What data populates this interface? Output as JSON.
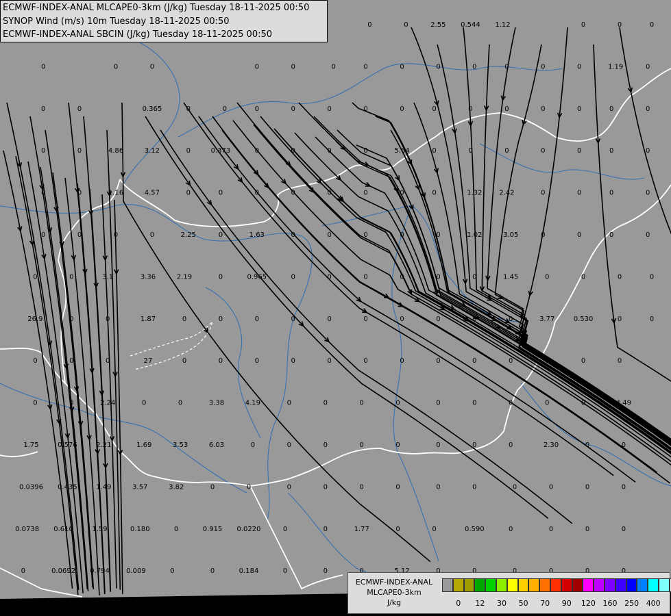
{
  "header": {
    "line1": "ECMWF-INDEX-ANAL MLCAPE0-3km (J/kg) Tuesday 18-11-2025 00:50",
    "line2": "SYNOP Wind (m/s) 10m Tuesday 18-11-2025 00:50",
    "line3": "ECMWF-INDEX-ANAL SBCIN (J/kg) Tuesday 18-11-2025 00:50"
  },
  "colors": {
    "background": "#999999",
    "rivers": "#2e6db4",
    "borders": "#ffffff",
    "streamlines": "#000000"
  },
  "value_labels": [
    {
      "text": "2.55",
      "col": 10.5,
      "row": 0
    },
    {
      "text": "0.544",
      "col": 11.3,
      "row": 0
    },
    {
      "text": "1.12",
      "col": 12.1,
      "row": 0
    },
    {
      "text": "0",
      "col": 8.8,
      "row": 0
    },
    {
      "text": "0",
      "col": 9.7,
      "row": 0
    },
    {
      "text": "0",
      "col": 14.1,
      "row": 0
    },
    {
      "text": "0",
      "col": 15.0,
      "row": 0
    },
    {
      "text": "0",
      "col": 15.8,
      "row": 0
    },
    {
      "text": "0",
      "col": 0.7,
      "row": 1
    },
    {
      "text": "0",
      "col": 2.5,
      "row": 1
    },
    {
      "text": "0",
      "col": 3.4,
      "row": 1
    },
    {
      "text": "0",
      "col": 6.0,
      "row": 1
    },
    {
      "text": "0",
      "col": 6.9,
      "row": 1
    },
    {
      "text": "0",
      "col": 7.9,
      "row": 1
    },
    {
      "text": "0",
      "col": 8.7,
      "row": 1
    },
    {
      "text": "0",
      "col": 9.6,
      "row": 1
    },
    {
      "text": "0",
      "col": 10.5,
      "row": 1
    },
    {
      "text": "0",
      "col": 11.4,
      "row": 1
    },
    {
      "text": "0",
      "col": 12.2,
      "row": 1
    },
    {
      "text": "0",
      "col": 13.1,
      "row": 1
    },
    {
      "text": "0",
      "col": 14.0,
      "row": 1
    },
    {
      "text": "1.19",
      "col": 14.9,
      "row": 1
    },
    {
      "text": "0",
      "col": 15.7,
      "row": 1
    },
    {
      "text": "0",
      "col": 0.7,
      "row": 2
    },
    {
      "text": "0",
      "col": 1.6,
      "row": 2
    },
    {
      "text": "0.365",
      "col": 3.4,
      "row": 2
    },
    {
      "text": "0",
      "col": 4.3,
      "row": 2
    },
    {
      "text": "0",
      "col": 5.2,
      "row": 2
    },
    {
      "text": "0",
      "col": 6.0,
      "row": 2
    },
    {
      "text": "0",
      "col": 6.9,
      "row": 2
    },
    {
      "text": "0",
      "col": 7.8,
      "row": 2
    },
    {
      "text": "0",
      "col": 8.7,
      "row": 2
    },
    {
      "text": "0",
      "col": 9.6,
      "row": 2
    },
    {
      "text": "0",
      "col": 10.4,
      "row": 2
    },
    {
      "text": "0",
      "col": 11.3,
      "row": 2
    },
    {
      "text": "0",
      "col": 12.2,
      "row": 2
    },
    {
      "text": "0",
      "col": 13.1,
      "row": 2
    },
    {
      "text": "0",
      "col": 14.0,
      "row": 2
    },
    {
      "text": "0",
      "col": 14.8,
      "row": 2
    },
    {
      "text": "0",
      "col": 15.7,
      "row": 2
    },
    {
      "text": "0",
      "col": 0.7,
      "row": 3
    },
    {
      "text": "0",
      "col": 1.6,
      "row": 3
    },
    {
      "text": "4.86",
      "col": 2.5,
      "row": 3
    },
    {
      "text": "3.12",
      "col": 3.4,
      "row": 3
    },
    {
      "text": "0",
      "col": 4.3,
      "row": 3
    },
    {
      "text": "0.373",
      "col": 5.1,
      "row": 3
    },
    {
      "text": "0",
      "col": 6.0,
      "row": 3
    },
    {
      "text": "0",
      "col": 6.9,
      "row": 3
    },
    {
      "text": "0",
      "col": 7.8,
      "row": 3
    },
    {
      "text": "0",
      "col": 8.7,
      "row": 3
    },
    {
      "text": "5.64",
      "col": 9.6,
      "row": 3
    },
    {
      "text": "0",
      "col": 10.4,
      "row": 3
    },
    {
      "text": "0",
      "col": 11.3,
      "row": 3
    },
    {
      "text": "0",
      "col": 12.2,
      "row": 3
    },
    {
      "text": "0",
      "col": 13.1,
      "row": 3
    },
    {
      "text": "0",
      "col": 14.0,
      "row": 3
    },
    {
      "text": "0",
      "col": 14.8,
      "row": 3
    },
    {
      "text": "0",
      "col": 15.7,
      "row": 3
    },
    {
      "text": "0",
      "col": 0.7,
      "row": 4
    },
    {
      "text": "0",
      "col": 1.6,
      "row": 4
    },
    {
      "text": "1.16",
      "col": 2.5,
      "row": 4
    },
    {
      "text": "4.57",
      "col": 3.4,
      "row": 4
    },
    {
      "text": "0",
      "col": 4.3,
      "row": 4
    },
    {
      "text": "0",
      "col": 5.1,
      "row": 4
    },
    {
      "text": "0",
      "col": 6.0,
      "row": 4
    },
    {
      "text": "0",
      "col": 6.9,
      "row": 4
    },
    {
      "text": "0",
      "col": 7.8,
      "row": 4
    },
    {
      "text": "0",
      "col": 8.7,
      "row": 4
    },
    {
      "text": "0",
      "col": 9.6,
      "row": 4
    },
    {
      "text": "0",
      "col": 10.4,
      "row": 4
    },
    {
      "text": "1.32",
      "col": 11.4,
      "row": 4
    },
    {
      "text": "2.42",
      "col": 12.2,
      "row": 4
    },
    {
      "text": "0",
      "col": 13.1,
      "row": 4
    },
    {
      "text": "0",
      "col": 14.0,
      "row": 4
    },
    {
      "text": "0",
      "col": 14.8,
      "row": 4
    },
    {
      "text": "0",
      "col": 15.7,
      "row": 4
    },
    {
      "text": "0",
      "col": 0.7,
      "row": 5
    },
    {
      "text": "0",
      "col": 1.6,
      "row": 5
    },
    {
      "text": "0",
      "col": 2.5,
      "row": 5
    },
    {
      "text": "0",
      "col": 3.4,
      "row": 5
    },
    {
      "text": "2.25",
      "col": 4.3,
      "row": 5
    },
    {
      "text": "0",
      "col": 5.1,
      "row": 5
    },
    {
      "text": "1.63",
      "col": 6.0,
      "row": 5
    },
    {
      "text": "0",
      "col": 6.9,
      "row": 5
    },
    {
      "text": "0",
      "col": 7.8,
      "row": 5
    },
    {
      "text": "0",
      "col": 8.7,
      "row": 5
    },
    {
      "text": "0",
      "col": 9.6,
      "row": 5
    },
    {
      "text": "0",
      "col": 10.5,
      "row": 5
    },
    {
      "text": "1.02",
      "col": 11.4,
      "row": 5
    },
    {
      "text": "3.05",
      "col": 12.3,
      "row": 5
    },
    {
      "text": "0",
      "col": 13.1,
      "row": 5
    },
    {
      "text": "0",
      "col": 14.0,
      "row": 5
    },
    {
      "text": "0",
      "col": 14.8,
      "row": 5
    },
    {
      "text": "0",
      "col": 15.7,
      "row": 5
    },
    {
      "text": "0",
      "col": 0.5,
      "row": 6
    },
    {
      "text": "0",
      "col": 1.4,
      "row": 6
    },
    {
      "text": "3.1",
      "col": 2.3,
      "row": 6
    },
    {
      "text": "3.36",
      "col": 3.3,
      "row": 6
    },
    {
      "text": "2.19",
      "col": 4.2,
      "row": 6
    },
    {
      "text": "0",
      "col": 5.1,
      "row": 6
    },
    {
      "text": "0.965",
      "col": 6.0,
      "row": 6
    },
    {
      "text": "0",
      "col": 6.9,
      "row": 6
    },
    {
      "text": "0",
      "col": 7.8,
      "row": 6
    },
    {
      "text": "0",
      "col": 8.7,
      "row": 6
    },
    {
      "text": "0",
      "col": 9.6,
      "row": 6
    },
    {
      "text": "0",
      "col": 10.5,
      "row": 6
    },
    {
      "text": "0",
      "col": 11.4,
      "row": 6
    },
    {
      "text": "1.45",
      "col": 12.3,
      "row": 6
    },
    {
      "text": "0",
      "col": 13.2,
      "row": 6
    },
    {
      "text": "0",
      "col": 14.1,
      "row": 6
    },
    {
      "text": "0",
      "col": 15.0,
      "row": 6
    },
    {
      "text": "0",
      "col": 15.8,
      "row": 6
    },
    {
      "text": "26.9",
      "col": 0.5,
      "row": 7
    },
    {
      "text": "0",
      "col": 1.4,
      "row": 7
    },
    {
      "text": "0",
      "col": 2.3,
      "row": 7
    },
    {
      "text": "1.87",
      "col": 3.3,
      "row": 7
    },
    {
      "text": "0",
      "col": 4.2,
      "row": 7
    },
    {
      "text": "0",
      "col": 5.1,
      "row": 7
    },
    {
      "text": "0",
      "col": 6.0,
      "row": 7
    },
    {
      "text": "0",
      "col": 6.9,
      "row": 7
    },
    {
      "text": "0",
      "col": 7.8,
      "row": 7
    },
    {
      "text": "0",
      "col": 8.7,
      "row": 7
    },
    {
      "text": "0",
      "col": 9.6,
      "row": 7
    },
    {
      "text": "0",
      "col": 10.5,
      "row": 7
    },
    {
      "text": "0",
      "col": 11.4,
      "row": 7
    },
    {
      "text": "0",
      "col": 12.3,
      "row": 7
    },
    {
      "text": "3.77",
      "col": 13.2,
      "row": 7
    },
    {
      "text": "0.530",
      "col": 14.1,
      "row": 7
    },
    {
      "text": "0",
      "col": 15.0,
      "row": 7
    },
    {
      "text": "0",
      "col": 15.8,
      "row": 7
    },
    {
      "text": "0",
      "col": 0.5,
      "row": 8
    },
    {
      "text": "0",
      "col": 1.4,
      "row": 8
    },
    {
      "text": "0",
      "col": 2.3,
      "row": 8
    },
    {
      "text": "27",
      "col": 3.3,
      "row": 8
    },
    {
      "text": "0",
      "col": 4.2,
      "row": 8
    },
    {
      "text": "0",
      "col": 5.1,
      "row": 8
    },
    {
      "text": "0",
      "col": 6.0,
      "row": 8
    },
    {
      "text": "0",
      "col": 6.9,
      "row": 8
    },
    {
      "text": "0",
      "col": 7.8,
      "row": 8
    },
    {
      "text": "0",
      "col": 8.7,
      "row": 8
    },
    {
      "text": "0",
      "col": 9.6,
      "row": 8
    },
    {
      "text": "0",
      "col": 10.5,
      "row": 8
    },
    {
      "text": "0",
      "col": 11.4,
      "row": 8
    },
    {
      "text": "0",
      "col": 12.3,
      "row": 8
    },
    {
      "text": "0",
      "col": 13.2,
      "row": 8
    },
    {
      "text": "0",
      "col": 14.1,
      "row": 8
    },
    {
      "text": "0",
      "col": 15.0,
      "row": 8
    },
    {
      "text": "0",
      "col": 0.5,
      "row": 9
    },
    {
      "text": "0",
      "col": 1.4,
      "row": 9
    },
    {
      "text": "2.24",
      "col": 2.3,
      "row": 9
    },
    {
      "text": "0",
      "col": 3.2,
      "row": 9
    },
    {
      "text": "0",
      "col": 4.1,
      "row": 9
    },
    {
      "text": "3.38",
      "col": 5.0,
      "row": 9
    },
    {
      "text": "4.19",
      "col": 5.9,
      "row": 9
    },
    {
      "text": "0",
      "col": 6.8,
      "row": 9
    },
    {
      "text": "0",
      "col": 7.7,
      "row": 9
    },
    {
      "text": "0",
      "col": 8.6,
      "row": 9
    },
    {
      "text": "0",
      "col": 9.5,
      "row": 9
    },
    {
      "text": "0",
      "col": 10.5,
      "row": 9
    },
    {
      "text": "0",
      "col": 11.4,
      "row": 9
    },
    {
      "text": "0",
      "col": 12.3,
      "row": 9
    },
    {
      "text": "0",
      "col": 13.2,
      "row": 9
    },
    {
      "text": "0",
      "col": 14.1,
      "row": 9
    },
    {
      "text": "4.49",
      "col": 15.1,
      "row": 9
    },
    {
      "text": "1.75",
      "col": 0.4,
      "row": 10
    },
    {
      "text": "0.576",
      "col": 1.3,
      "row": 10
    },
    {
      "text": "2.21",
      "col": 2.2,
      "row": 10
    },
    {
      "text": "1.69",
      "col": 3.2,
      "row": 10
    },
    {
      "text": "3.53",
      "col": 4.1,
      "row": 10
    },
    {
      "text": "6.03",
      "col": 5.0,
      "row": 10
    },
    {
      "text": "0",
      "col": 5.9,
      "row": 10
    },
    {
      "text": "0",
      "col": 6.8,
      "row": 10
    },
    {
      "text": "0",
      "col": 7.7,
      "row": 10
    },
    {
      "text": "0",
      "col": 8.6,
      "row": 10
    },
    {
      "text": "0",
      "col": 9.5,
      "row": 10
    },
    {
      "text": "0",
      "col": 10.5,
      "row": 10
    },
    {
      "text": "0",
      "col": 11.4,
      "row": 10
    },
    {
      "text": "0",
      "col": 12.3,
      "row": 10
    },
    {
      "text": "2.30",
      "col": 13.3,
      "row": 10
    },
    {
      "text": "0",
      "col": 14.2,
      "row": 10
    },
    {
      "text": "0",
      "col": 15.1,
      "row": 10
    },
    {
      "text": "0.0396",
      "col": 0.4,
      "row": 11
    },
    {
      "text": "0.435",
      "col": 1.3,
      "row": 11
    },
    {
      "text": "1.49",
      "col": 2.2,
      "row": 11
    },
    {
      "text": "3.57",
      "col": 3.1,
      "row": 11
    },
    {
      "text": "3.82",
      "col": 4.0,
      "row": 11
    },
    {
      "text": "0",
      "col": 4.9,
      "row": 11
    },
    {
      "text": "0",
      "col": 5.8,
      "row": 11
    },
    {
      "text": "0",
      "col": 6.8,
      "row": 11
    },
    {
      "text": "0",
      "col": 7.7,
      "row": 11
    },
    {
      "text": "0",
      "col": 8.6,
      "row": 11
    },
    {
      "text": "0",
      "col": 9.5,
      "row": 11
    },
    {
      "text": "0",
      "col": 10.5,
      "row": 11
    },
    {
      "text": "0",
      "col": 11.4,
      "row": 11
    },
    {
      "text": "0",
      "col": 12.4,
      "row": 11
    },
    {
      "text": "0",
      "col": 13.3,
      "row": 11
    },
    {
      "text": "0",
      "col": 14.2,
      "row": 11
    },
    {
      "text": "0",
      "col": 15.1,
      "row": 11
    },
    {
      "text": "0.0738",
      "col": 0.3,
      "row": 12
    },
    {
      "text": "0.610",
      "col": 1.2,
      "row": 12
    },
    {
      "text": "1.59",
      "col": 2.1,
      "row": 12
    },
    {
      "text": "0.180",
      "col": 3.1,
      "row": 12
    },
    {
      "text": "0",
      "col": 4.0,
      "row": 12
    },
    {
      "text": "0.915",
      "col": 4.9,
      "row": 12
    },
    {
      "text": "0.0220",
      "col": 5.8,
      "row": 12
    },
    {
      "text": "0",
      "col": 6.7,
      "row": 12
    },
    {
      "text": "0",
      "col": 7.7,
      "row": 12
    },
    {
      "text": "1.77",
      "col": 8.6,
      "row": 12
    },
    {
      "text": "0",
      "col": 9.5,
      "row": 12
    },
    {
      "text": "0",
      "col": 10.4,
      "row": 12
    },
    {
      "text": "0.590",
      "col": 11.4,
      "row": 12
    },
    {
      "text": "0",
      "col": 12.3,
      "row": 12
    },
    {
      "text": "0",
      "col": 13.3,
      "row": 12
    },
    {
      "text": "0",
      "col": 14.2,
      "row": 12
    },
    {
      "text": "0",
      "col": 15.1,
      "row": 12
    },
    {
      "text": "0",
      "col": 0.2,
      "row": 13
    },
    {
      "text": "0.0692",
      "col": 1.2,
      "row": 13
    },
    {
      "text": "0.794",
      "col": 2.1,
      "row": 13
    },
    {
      "text": "0.009",
      "col": 3.0,
      "row": 13
    },
    {
      "text": "0",
      "col": 3.9,
      "row": 13
    },
    {
      "text": "0",
      "col": 4.9,
      "row": 13
    },
    {
      "text": "0.184",
      "col": 5.8,
      "row": 13
    },
    {
      "text": "0",
      "col": 6.7,
      "row": 13
    },
    {
      "text": "0",
      "col": 7.7,
      "row": 13
    },
    {
      "text": "0",
      "col": 8.6,
      "row": 13
    },
    {
      "text": "5.12",
      "col": 9.6,
      "row": 13
    },
    {
      "text": "0",
      "col": 10.5,
      "row": 13
    },
    {
      "text": "0",
      "col": 11.4,
      "row": 13
    },
    {
      "text": "0",
      "col": 12.4,
      "row": 13
    },
    {
      "text": "0",
      "col": 13.3,
      "row": 13
    },
    {
      "text": "0",
      "col": 14.2,
      "row": 13
    },
    {
      "text": "0",
      "col": 15.1,
      "row": 13
    }
  ],
  "legend": {
    "title_line1": "ECMWF-INDEX-ANAL",
    "title_line2": "MLCAPE0-3km",
    "title_line3": "J/kg",
    "colors": [
      "#9a9a9a",
      "#b5a800",
      "#9c9c00",
      "#00a800",
      "#00d400",
      "#8cf000",
      "#ffff00",
      "#ffd000",
      "#ffb000",
      "#ff7000",
      "#ff3000",
      "#d40000",
      "#a00000",
      "#ff00ff",
      "#c000ff",
      "#8000ff",
      "#4000ff",
      "#0000ff",
      "#0080ff",
      "#00ffff",
      "#80ffff",
      "#ffffff"
    ],
    "ticks": [
      {
        "label": "0",
        "index": 1
      },
      {
        "label": "12",
        "index": 3
      },
      {
        "label": "30",
        "index": 5
      },
      {
        "label": "50",
        "index": 7
      },
      {
        "label": "70",
        "index": 9
      },
      {
        "label": "90",
        "index": 11
      },
      {
        "label": "120",
        "index": 13
      },
      {
        "label": "160",
        "index": 15
      },
      {
        "label": "250",
        "index": 17
      },
      {
        "label": "400",
        "index": 19
      }
    ]
  }
}
